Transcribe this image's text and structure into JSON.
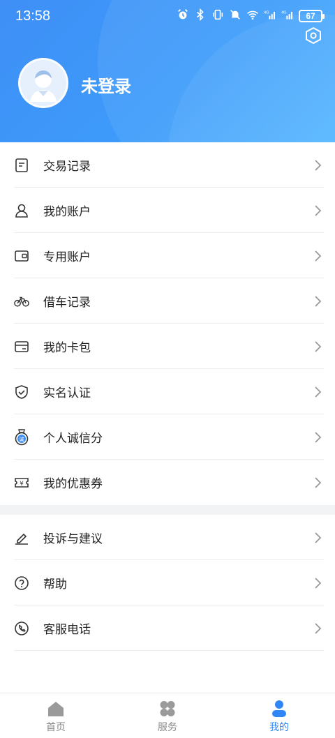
{
  "status_bar": {
    "time": "13:58",
    "battery": "67",
    "network_1": "4G",
    "network_2": "4G",
    "wifi_num": "6"
  },
  "profile": {
    "login_status": "未登录"
  },
  "menu_group_1": [
    {
      "label": "交易记录",
      "icon": "receipt-icon"
    },
    {
      "label": "我的账户",
      "icon": "user-icon"
    },
    {
      "label": "专用账户",
      "icon": "wallet-icon"
    },
    {
      "label": "借车记录",
      "icon": "bicycle-icon"
    },
    {
      "label": "我的卡包",
      "icon": "card-icon"
    },
    {
      "label": "实名认证",
      "icon": "shield-check-icon"
    },
    {
      "label": "个人诚信分",
      "icon": "integrity-badge-icon"
    },
    {
      "label": "我的优惠券",
      "icon": "coupon-icon"
    }
  ],
  "menu_group_2": [
    {
      "label": "投诉与建议",
      "icon": "edit-icon"
    },
    {
      "label": "帮助",
      "icon": "help-icon"
    },
    {
      "label": "客服电话",
      "icon": "phone-icon"
    }
  ],
  "integrity_badge_char": "诚",
  "coupon_symbol": "¥",
  "tabs": [
    {
      "label": "首页",
      "icon": "home-icon",
      "active": false
    },
    {
      "label": "服务",
      "icon": "grid-icon",
      "active": false
    },
    {
      "label": "我的",
      "icon": "profile-icon",
      "active": true
    }
  ],
  "colors": {
    "accent": "#2f86f6",
    "header_start": "#3f8ff6",
    "header_end": "#4bb3ff",
    "inactive_tab": "#888888"
  }
}
